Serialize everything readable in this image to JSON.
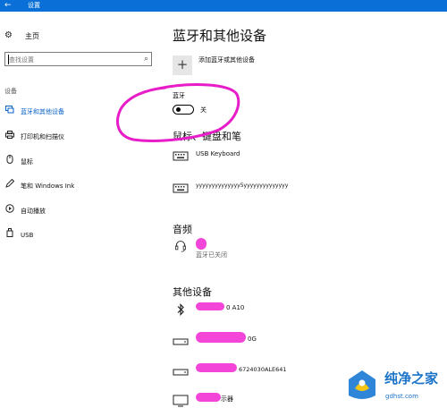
{
  "window": {
    "title": "设置",
    "back_glyph": "←"
  },
  "sidebar": {
    "home_label": "主页",
    "search_placeholder": "查找设置",
    "section_label": "设备",
    "items": [
      {
        "label": "蓝牙和其他设备",
        "icon": "bluetooth-devices-icon",
        "active": true
      },
      {
        "label": "打印机和扫描仪",
        "icon": "printer-icon",
        "active": false
      },
      {
        "label": "鼠标",
        "icon": "mouse-icon",
        "active": false
      },
      {
        "label": "笔和 Windows Ink",
        "icon": "pen-icon",
        "active": false
      },
      {
        "label": "自动播放",
        "icon": "autoplay-icon",
        "active": false
      },
      {
        "label": "USB",
        "icon": "usb-icon",
        "active": false
      }
    ]
  },
  "main": {
    "title": "蓝牙和其他设备",
    "add_device_label": "添加蓝牙或其他设备",
    "bluetooth": {
      "label": "蓝牙",
      "state_label": "关",
      "on": false
    },
    "mouse_section": {
      "title": "鼠标、键盘和笔",
      "devices": [
        {
          "name": "USB Keyboard",
          "icon": "keyboard-icon"
        },
        {
          "name": "yyyyyyyyyyyyyy5yyyyyyyyyyyyyy",
          "icon": "keyboard-icon"
        }
      ]
    },
    "audio_section": {
      "title": "音频",
      "devices": [
        {
          "name": "",
          "status": "蓝牙已关闭",
          "icon": "headset-icon"
        }
      ]
    },
    "other_section": {
      "title": "其他设备",
      "devices": [
        {
          "name": "0 A10",
          "icon": "bluetooth-icon"
        },
        {
          "name": "0G",
          "icon": "drive-icon"
        },
        {
          "name": "6724030ALE641",
          "icon": "drive-icon"
        },
        {
          "name": "示器",
          "icon": "monitor-icon"
        }
      ]
    }
  },
  "watermark": {
    "brand": "纯净之家",
    "url": "gdhst.com"
  },
  "colors": {
    "titlebar": "#0a6fd6",
    "accent": "#0a63c9",
    "annotation": "#e81cc8",
    "redaction": "#f23bd6",
    "watermark": "#1a73c9"
  }
}
